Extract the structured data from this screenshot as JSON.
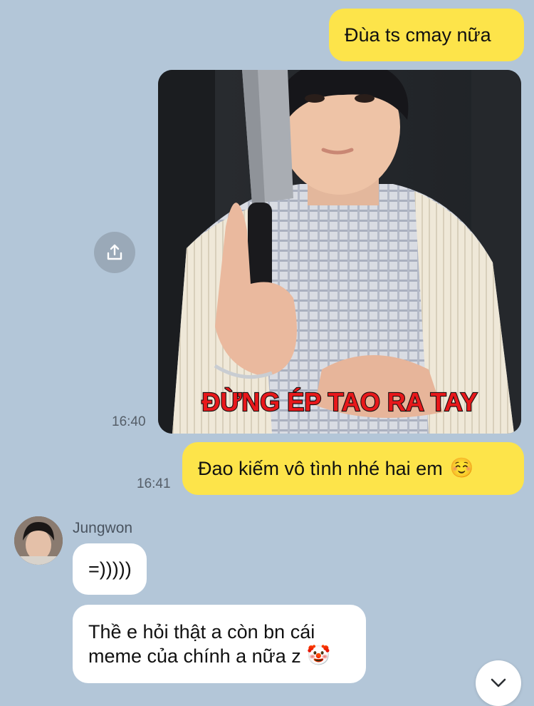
{
  "colors": {
    "background": "#b3c6d8",
    "outgoing_bubble": "#fde44a",
    "incoming_bubble": "#ffffff"
  },
  "messages": {
    "m1": {
      "text": "Đùa ts cmay nữa"
    },
    "m2": {
      "caption": "ĐỪNG ÉP TAO RA TAY",
      "time": "16:40",
      "share_icon": "share-icon"
    },
    "m3": {
      "text": "Đao kiếm vô tình nhé hai em",
      "emoji": "☺️",
      "time": "16:41"
    },
    "m4": {
      "sender": "Jungwon",
      "text": "=)))))"
    },
    "m5": {
      "line1": "Thề e hỏi thật a còn bn cái",
      "line2": "meme của chính a nữa z",
      "emoji": "🤡"
    }
  },
  "controls": {
    "scroll_down_icon": "chevron-down-icon"
  }
}
